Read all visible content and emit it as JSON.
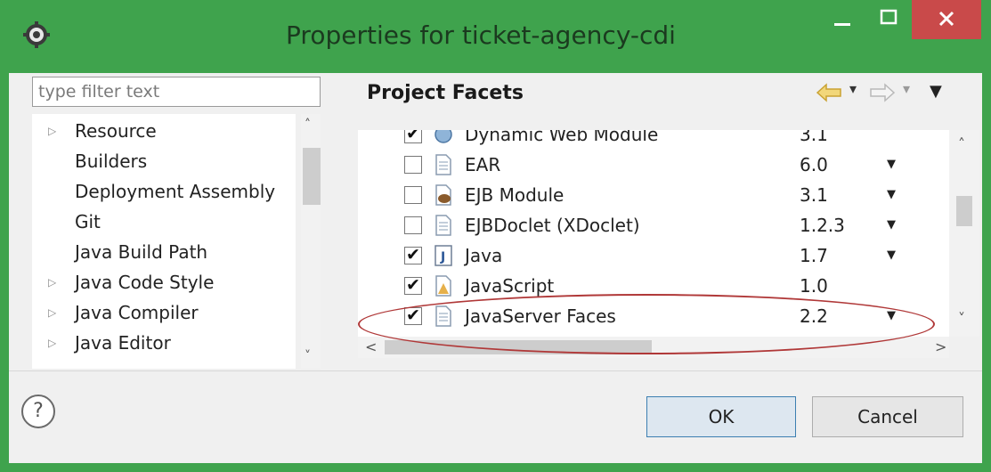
{
  "window": {
    "title": "Properties for ticket-agency-cdi",
    "controls": {
      "minimize": "–",
      "maximize": "☐",
      "close": "✕"
    },
    "colors": {
      "frame": "#3fa34d",
      "close": "#c94a4a"
    }
  },
  "filter": {
    "placeholder": "type filter text"
  },
  "sidebar": {
    "items": [
      {
        "label": "Resource",
        "arrow": "▷"
      },
      {
        "label": "Builders",
        "arrow": ""
      },
      {
        "label": "Deployment Assembly",
        "arrow": ""
      },
      {
        "label": "Git",
        "arrow": ""
      },
      {
        "label": "Java Build Path",
        "arrow": ""
      },
      {
        "label": "Java Code Style",
        "arrow": "▷"
      },
      {
        "label": "Java Compiler",
        "arrow": "▷"
      },
      {
        "label": "Java Editor",
        "arrow": "▷"
      }
    ],
    "scroll_up": "˄",
    "scroll_down": "˅"
  },
  "page": {
    "title": "Project Facets",
    "nav": {
      "back_menu": "▾",
      "forward_menu": "▾",
      "view_menu": "▼"
    }
  },
  "facets": {
    "rows": [
      {
        "name": "Dynamic Web Module",
        "version": "3.1",
        "checked": true,
        "icon": "web-module-icon"
      },
      {
        "name": "EAR",
        "version": "6.0",
        "checked": false,
        "icon": "document-icon"
      },
      {
        "name": "EJB Module",
        "version": "3.1",
        "checked": false,
        "icon": "ejb-bean-icon"
      },
      {
        "name": "EJBDoclet (XDoclet)",
        "version": "1.2.3",
        "checked": false,
        "icon": "document-icon"
      },
      {
        "name": "Java",
        "version": "1.7",
        "checked": true,
        "icon": "java-icon"
      },
      {
        "name": "JavaScript",
        "version": "1.0",
        "checked": true,
        "icon": "javascript-icon"
      },
      {
        "name": "JavaServer Faces",
        "version": "2.2",
        "checked": true,
        "icon": "document-icon"
      }
    ],
    "dropdown_arrow": "▼",
    "check_mark": "✔",
    "scroll_up": "˄",
    "scroll_down": "˅",
    "scroll_left": "<",
    "scroll_right": ">",
    "highlight_color": "#b03838"
  },
  "footer": {
    "help": "?",
    "ok_label": "OK",
    "cancel_label": "Cancel"
  }
}
